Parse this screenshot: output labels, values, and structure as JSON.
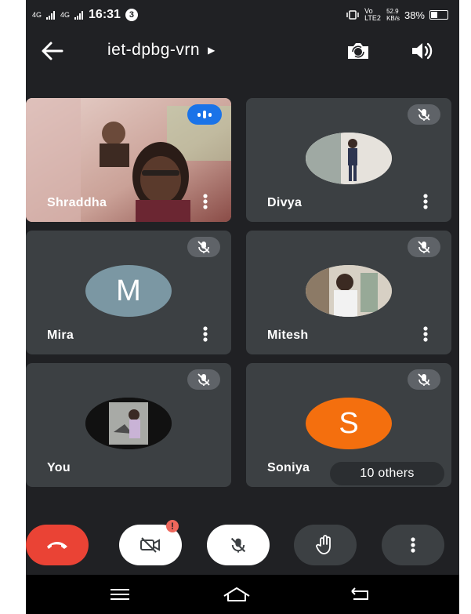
{
  "status_bar": {
    "network_1": "4G",
    "network_2": "4G",
    "time": "16:31",
    "notification_badge": "3",
    "volte_label": "Vo LTE2",
    "data_speed": "52.9",
    "data_unit": "KB/s",
    "battery": "38%",
    "battery_level": 0.38
  },
  "header": {
    "meeting_code": "iet-dpbg-vrn",
    "icons": [
      "back-arrow-icon",
      "switch-camera-icon",
      "speaker-icon"
    ]
  },
  "participants": [
    {
      "name": "Shraddha",
      "status": "speaking",
      "video": true
    },
    {
      "name": "Divya",
      "status": "muted",
      "avatar": "photo"
    },
    {
      "name": "Mira",
      "status": "muted",
      "avatar_letter": "M",
      "avatar_color": "#7b97a3"
    },
    {
      "name": "Mitesh",
      "status": "muted",
      "avatar": "photo"
    },
    {
      "name": "You",
      "status": "muted",
      "avatar": "photo"
    },
    {
      "name": "Soniya",
      "status": "muted",
      "avatar_letter": "S",
      "avatar_color": "#f46f0e",
      "others_label": "10 others"
    }
  ],
  "controls": {
    "end_call_color": "#ea4335",
    "camera_alert": "!",
    "items": [
      "end-call-icon",
      "camera-off-icon",
      "mic-off-icon",
      "raise-hand-icon",
      "more-options-icon"
    ]
  },
  "colors": {
    "background": "#202124",
    "tile": "#3c4043",
    "speaking_badge": "#1a73e8"
  }
}
